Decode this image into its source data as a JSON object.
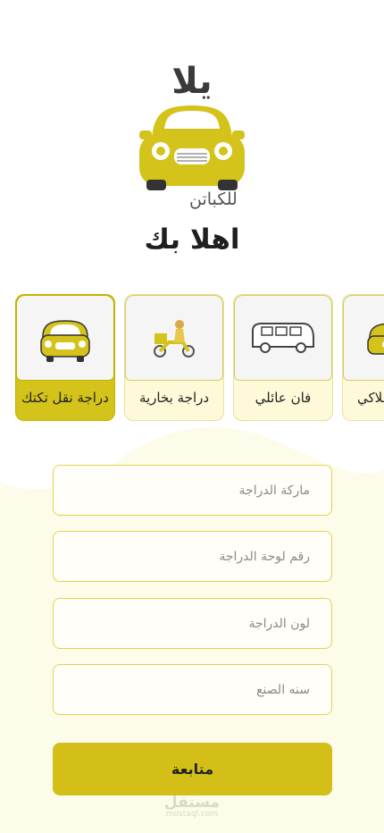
{
  "brand": {
    "logo_word": "يلا",
    "tagline": "للكباتن"
  },
  "welcome_title": "اهلا بك",
  "vehicles": [
    {
      "label": "دراجة نقل تكتك",
      "icon": "tuktuk-icon",
      "selected": true
    },
    {
      "label": "دراجة بخارية",
      "icon": "motorbike-icon",
      "selected": false
    },
    {
      "label": "فان عائلي",
      "icon": "van-icon",
      "selected": false
    },
    {
      "label": "ملاكي",
      "icon": "car-icon",
      "selected": false
    }
  ],
  "form": {
    "brand_placeholder": "ماركة الدراجة",
    "plate_placeholder": "رقم لوحة الدراجة",
    "color_placeholder": "لون الدراجة",
    "year_placeholder": "سنه الصنع"
  },
  "continue_label": "متابعة",
  "watermark": {
    "text": "مستقل",
    "sub": "mostaql.com"
  },
  "colors": {
    "accent": "#d3bf18",
    "card_bg": "#fdf9d9",
    "field_border": "#e3d34a"
  }
}
